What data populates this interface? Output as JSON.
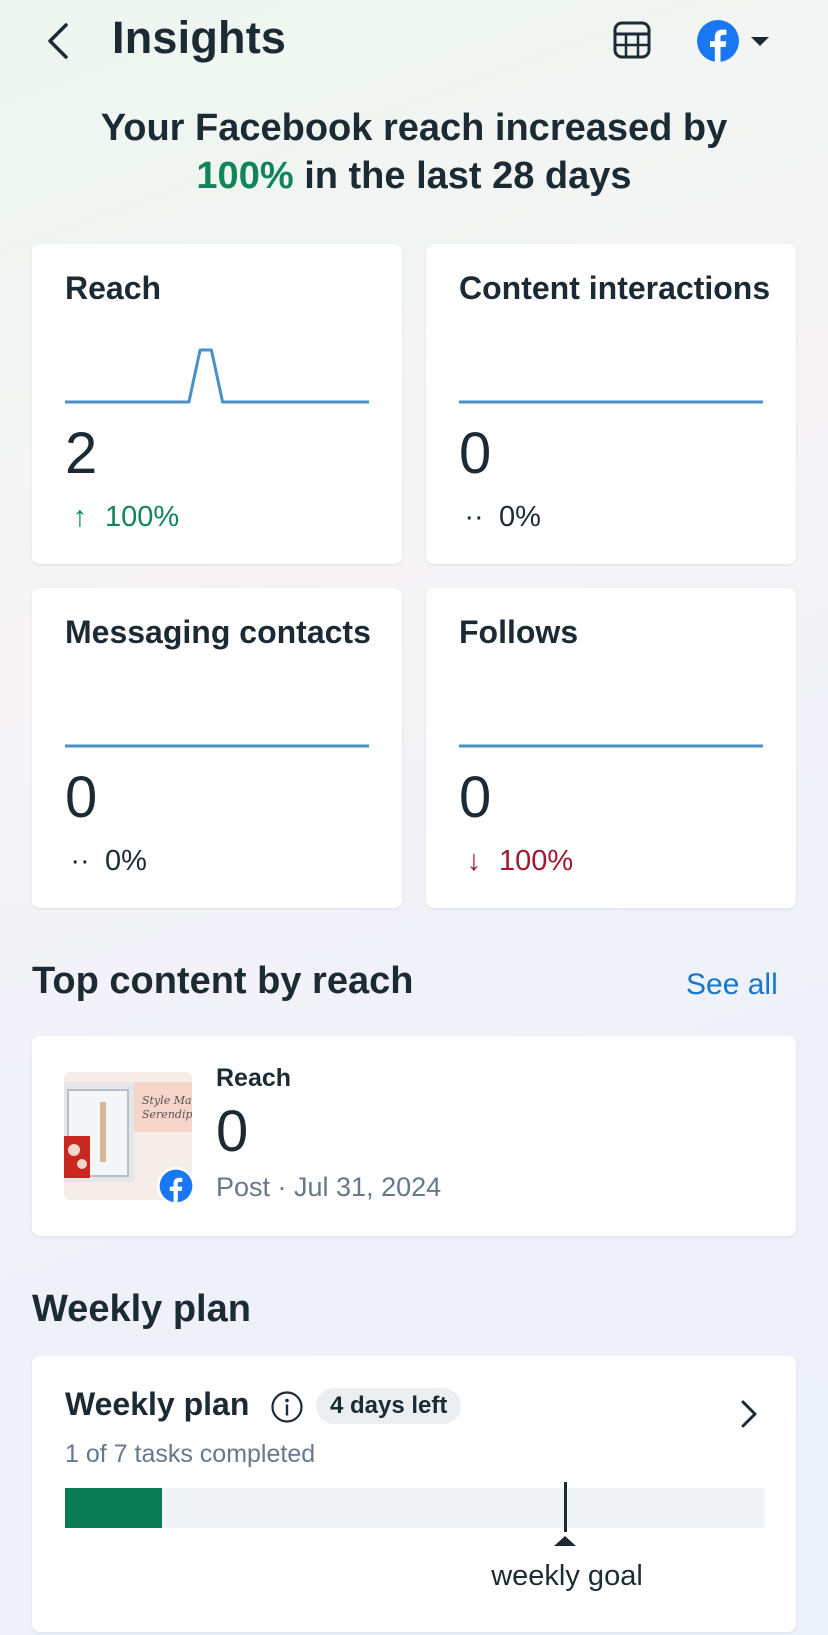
{
  "header": {
    "title": "Insights",
    "back_icon": "back-arrow-icon",
    "table_icon": "table-icon",
    "account_icon": "facebook-logo-icon",
    "dropdown_icon": "caret-down-icon"
  },
  "headline": {
    "prefix": "Your Facebook reach increased by",
    "percent": "100%",
    "suffix": "in the last 28 days"
  },
  "metrics": [
    {
      "title": "Reach",
      "value": "2",
      "change": "100%",
      "direction": "up",
      "arrow": "↑",
      "sparkline": [
        0,
        0,
        0,
        0,
        0,
        0,
        0,
        0,
        0,
        0,
        0,
        0,
        1,
        1,
        0,
        0,
        0,
        0,
        0,
        0,
        0,
        0,
        0,
        0,
        0,
        0,
        0,
        0
      ]
    },
    {
      "title": "Content interactions",
      "value": "0",
      "change": "0%",
      "direction": "neutral",
      "arrow": "··",
      "sparkline": []
    },
    {
      "title": "Messaging contacts",
      "value": "0",
      "change": "0%",
      "direction": "neutral",
      "arrow": "··",
      "sparkline": []
    },
    {
      "title": "Follows",
      "value": "0",
      "change": "100%",
      "direction": "down",
      "arrow": "↓",
      "sparkline": []
    }
  ],
  "top_content": {
    "title": "Top content by reach",
    "see_all": "See all",
    "post": {
      "label": "Reach",
      "value": "0",
      "meta": "Post · Jul 31, 2024",
      "thumb_text": "Style Ma Serendip",
      "badge_icon": "facebook-logo-icon"
    }
  },
  "weekly_plan": {
    "section_title": "Weekly plan",
    "card_title": "Weekly plan",
    "days_left": "4 days left",
    "tasks_text": "1 of 7 tasks completed",
    "completed": 1,
    "total": 7,
    "goal_label": "weekly goal",
    "colors": {
      "fill": "#0a7b55",
      "track": "#f1f4f7"
    }
  },
  "colors": {
    "positive": "#11845b",
    "negative": "#a0192f",
    "link": "#1877c9",
    "chart_line": "#4a90c9",
    "facebook": "#1877f2"
  }
}
